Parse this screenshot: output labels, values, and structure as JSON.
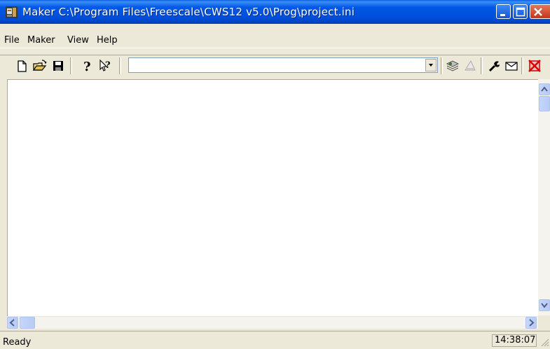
{
  "window": {
    "title": "Maker  C:\\Program Files\\Freescale\\CWS12 v5.0\\Prog\\project.ini"
  },
  "menu": {
    "items": [
      "File",
      "Maker",
      "View",
      "Help"
    ]
  },
  "toolbar": {
    "combo_value": "",
    "icons": [
      "new-file-icon",
      "open-folder-icon",
      "save-icon",
      "help-icon",
      "context-help-icon",
      "make-icon",
      "stop-icon",
      "options-icon",
      "mail-icon",
      "close-red-icon"
    ]
  },
  "status": {
    "text": "Ready",
    "time": "14:38:07"
  }
}
